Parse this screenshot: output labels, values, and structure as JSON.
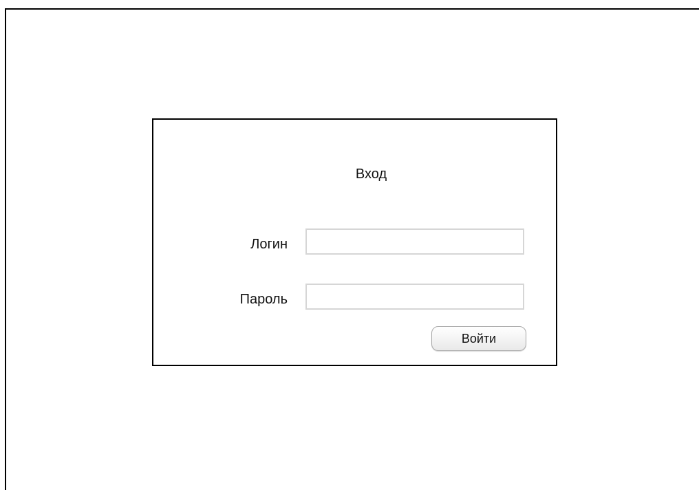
{
  "login_form": {
    "title": "Вход",
    "login_label": "Логин",
    "login_value": "",
    "login_placeholder": "",
    "password_label": "Пароль",
    "password_value": "",
    "password_placeholder": "",
    "submit_label": "Войти"
  }
}
